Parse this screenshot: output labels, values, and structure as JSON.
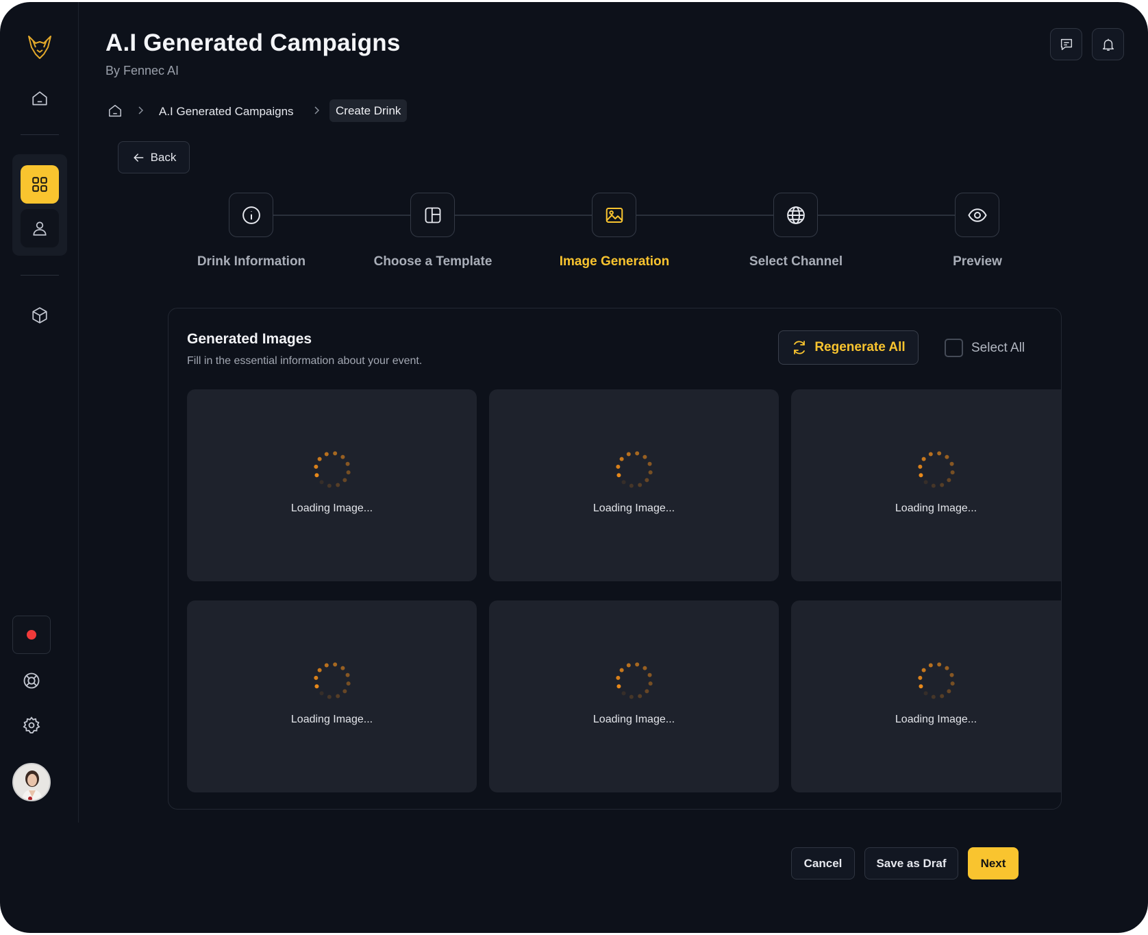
{
  "header": {
    "title": "A.I Generated Campaigns",
    "subtitle": "By Fennec AI"
  },
  "breadcrumb": {
    "items": [
      "A.I Generated Campaigns",
      "Create Drink"
    ]
  },
  "back_label": "Back",
  "steps": [
    {
      "label": "Drink Information",
      "icon": "info-icon"
    },
    {
      "label": "Choose a Template",
      "icon": "template-icon"
    },
    {
      "label": "Image Generation",
      "icon": "image-icon",
      "current": true
    },
    {
      "label": "Select Channel",
      "icon": "globe-icon"
    },
    {
      "label": "Preview",
      "icon": "eye-icon"
    }
  ],
  "panel": {
    "title": "Generated Images",
    "subtitle": "Fill in the essential information about your event.",
    "regenerate_label": "Regenerate All",
    "select_all_label": "Select All",
    "cards": [
      "Loading Image...",
      "Loading Image...",
      "Loading Image...",
      "Loading Image...",
      "Loading Image...",
      "Loading Image..."
    ]
  },
  "footer": {
    "cancel": "Cancel",
    "save": "Save as Draf",
    "next": "Next"
  },
  "colors": {
    "accent": "#f9c42f",
    "background": "#0d111a",
    "card": "#1e222c",
    "recording": "#f03a3a",
    "spinner": "#e8891a"
  }
}
